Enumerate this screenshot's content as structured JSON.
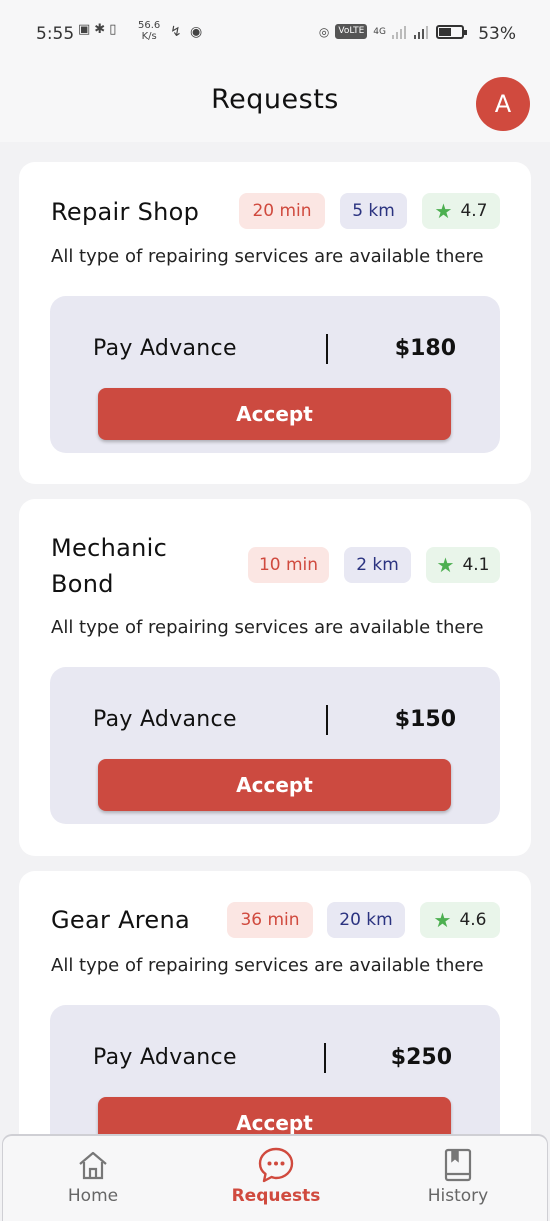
{
  "status_bar": {
    "time": "5:55",
    "speed_value": "56.6",
    "speed_unit": "K/s",
    "network": "4G",
    "volte": "VoLTE",
    "battery_percent": "53%",
    "battery_level": 0.53
  },
  "header": {
    "title": "Requests",
    "avatar_letter": "A"
  },
  "requests": [
    {
      "name": "Repair Shop",
      "time": "20 min",
      "distance": "5 km",
      "rating": "4.7",
      "description": "All type of repairing services are available there",
      "pay_label": "Pay Advance",
      "amount": "$180",
      "accept_label": "Accept"
    },
    {
      "name": "Mechanic Bond",
      "time": "10 min",
      "distance": "2 km",
      "rating": "4.1",
      "description": "All type of repairing services are available there",
      "pay_label": "Pay Advance",
      "amount": "$150",
      "accept_label": "Accept"
    },
    {
      "name": "Gear Arena",
      "time": "36 min",
      "distance": "20 km",
      "rating": "4.6",
      "description": "All type of repairing services are available there",
      "pay_label": "Pay Advance",
      "amount": "$250",
      "accept_label": "Accept"
    }
  ],
  "bottom_nav": {
    "items": [
      {
        "label": "Home",
        "icon": "home-icon",
        "active": false
      },
      {
        "label": "Requests",
        "icon": "chat-bubble-icon",
        "active": true
      },
      {
        "label": "History",
        "icon": "book-icon",
        "active": false
      }
    ]
  },
  "colors": {
    "accent": "#cc4a40",
    "time_chip_bg": "#fbe6e3",
    "distance_chip_bg": "#e8e8f3",
    "rating_chip_bg": "#e9f5ea",
    "star": "#4caf50"
  }
}
